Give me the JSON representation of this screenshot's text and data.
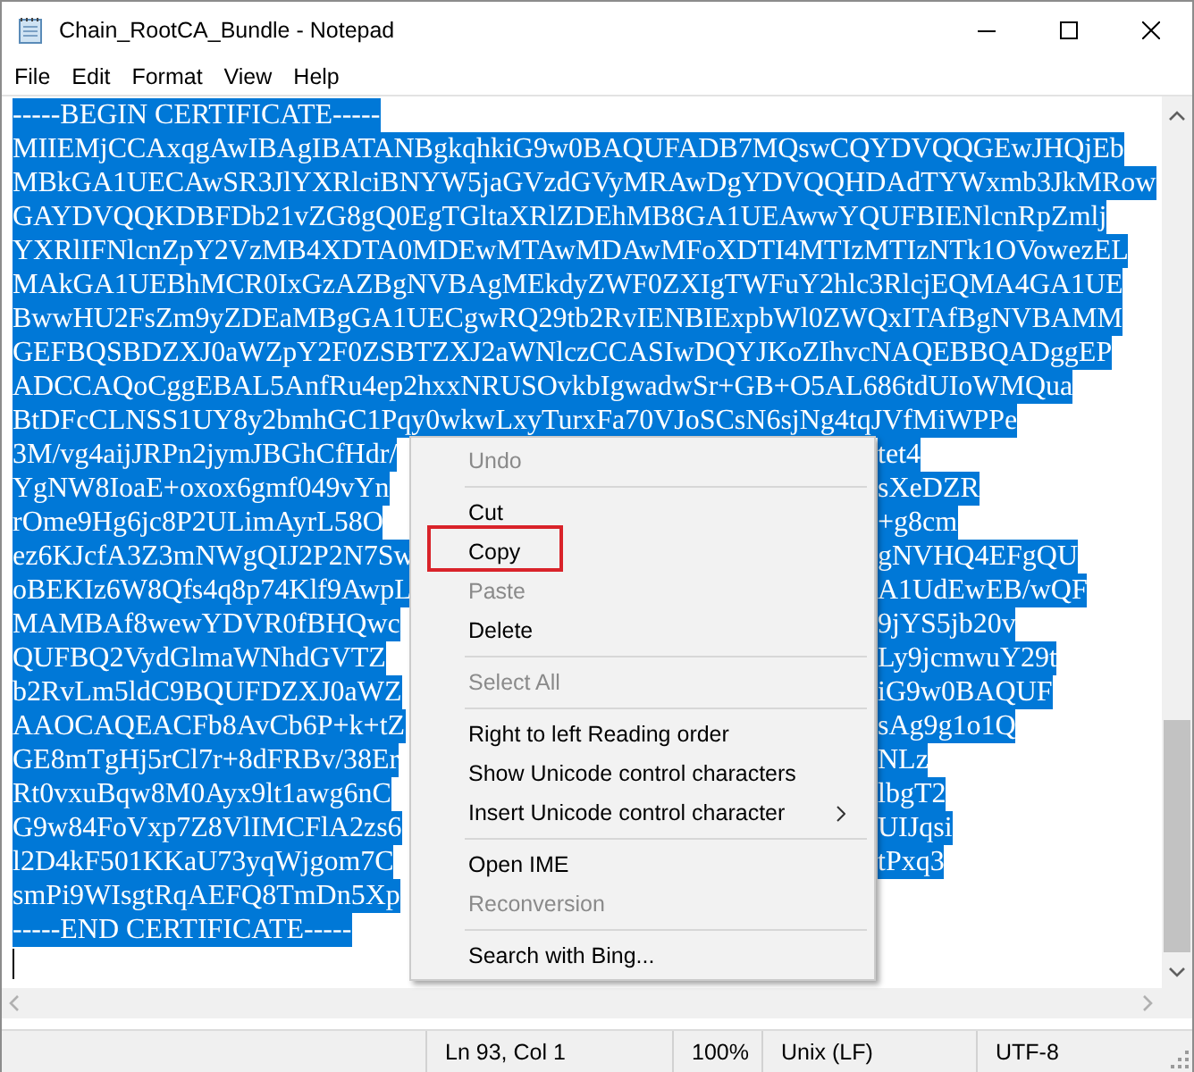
{
  "window": {
    "title": "Chain_RootCA_Bundle - Notepad"
  },
  "menu_bar": [
    "File",
    "Edit",
    "Format",
    "View",
    "Help"
  ],
  "editor": {
    "selected": true,
    "lines": [
      {
        "kind": "full",
        "text": "-----BEGIN CERTIFICATE-----"
      },
      {
        "kind": "full",
        "text": "MIIEMjCCAxqgAwIBAgIBATANBgkqhkiG9w0BAQUFADB7MQswCQYDVQQGEwJHQjEb"
      },
      {
        "kind": "full",
        "text": "MBkGA1UECAwSR3JlYXRlciBNYW5jaGVzdGVyMRAwDgYDVQQHDAdTYWxmb3JkMRow"
      },
      {
        "kind": "full",
        "text": "GAYDVQQKDBFDb21vZG8gQ0EgTGltaXRlZDEhMB8GA1UEAwwYQUFBIENlcnRpZmlj"
      },
      {
        "kind": "full",
        "text": "YXRlIFNlcnZpY2VzMB4XDTA0MDEwMTAwMDAwMFoXDTI4MTIzMTIzNTk1OVowezEL"
      },
      {
        "kind": "full",
        "text": "MAkGA1UEBhMCR0IxGzAZBgNVBAgMEkdyZWF0ZXIgTWFuY2hlc3RlcjEQMA4GA1UE"
      },
      {
        "kind": "full",
        "text": "BwwHU2FsZm9yZDEaMBgGA1UECgwRQ29tb2RvIENBIExpbWl0ZWQxITAfBgNVBAMM"
      },
      {
        "kind": "full",
        "text": "GEFBQSBDZXJ0aWZpY2F0ZSBTZXJ2aWNlczCCASIwDQYJKoZIhvcNAQEBBQADggEP"
      },
      {
        "kind": "full",
        "text": "ADCCAQoCggEBAL5AnfRu4ep2hxxNRUSOvkbIgwadwSr+GB+O5AL686tdUIoWMQua"
      },
      {
        "kind": "full",
        "text": "BtDFcCLNSS1UY8y2bmhGC1Pqy0wkwLxyTurxFa70VJoSCsN6sjNg4tqJVfMiWPPe"
      },
      {
        "kind": "split",
        "left": "3M/vg4aijJRPn2jymJBGhCfHdr/",
        "right": "tet4"
      },
      {
        "kind": "split",
        "left": "YgNW8IoaE+oxox6gmf049vYn",
        "right": "sXeDZR"
      },
      {
        "kind": "split",
        "left": "rOme9Hg6jc8P2ULimAyrL58O",
        "right": "+g8cm"
      },
      {
        "kind": "split",
        "left": "ez6KJcfA3Z3mNWgQIJ2P2N7Sw",
        "right": "gNVHQ4EFgQU"
      },
      {
        "kind": "split",
        "left": "oBEKIz6W8Qfs4q8p74Klf9AwpL",
        "right": "A1UdEwEB/wQF"
      },
      {
        "kind": "split",
        "left": "MAMBAf8wewYDVR0fBHQwc",
        "right": "9jYS5jb20v"
      },
      {
        "kind": "split",
        "left": "QUFBQ2VydGlmaWNhdGVTZ",
        "right": "Ly9jcmwuY29t"
      },
      {
        "kind": "split",
        "left": "b2RvLm5ldC9BQUFDZXJ0aWZ",
        "right": "iG9w0BAQUF"
      },
      {
        "kind": "split",
        "left": "AAOCAQEACFb8AvCb6P+k+tZ",
        "right": "sAg9g1o1Q"
      },
      {
        "kind": "split",
        "left": "GE8mTgHj5rCl7r+8dFRBv/38Er",
        "right": "NLz"
      },
      {
        "kind": "split",
        "left": "Rt0vxuBqw8M0Ayx9lt1awg6nC",
        "right": "lbgT2"
      },
      {
        "kind": "split",
        "left": "G9w84FoVxp7Z8VlIMCFlA2zs6",
        "right": "UIJqsi"
      },
      {
        "kind": "split",
        "left": "l2D4kF501KKaU73yqWjgom7C",
        "right": "tPxq3"
      },
      {
        "kind": "split",
        "left": "smPi9WIsgtRqAEFQ8TmDn5Xp"
      },
      {
        "kind": "full",
        "text": "-----END CERTIFICATE-----"
      }
    ]
  },
  "context_menu": {
    "items": [
      {
        "kind": "item",
        "label": "Undo",
        "disabled": true,
        "annotated": false
      },
      {
        "kind": "separator"
      },
      {
        "kind": "item",
        "label": "Cut",
        "disabled": false,
        "annotated": false
      },
      {
        "kind": "item",
        "label": "Copy",
        "disabled": false,
        "annotated": true
      },
      {
        "kind": "item",
        "label": "Paste",
        "disabled": true,
        "annotated": false
      },
      {
        "kind": "item",
        "label": "Delete",
        "disabled": false,
        "annotated": false
      },
      {
        "kind": "separator"
      },
      {
        "kind": "item",
        "label": "Select All",
        "disabled": true,
        "annotated": false
      },
      {
        "kind": "separator"
      },
      {
        "kind": "item",
        "label": "Right to left Reading order",
        "disabled": false,
        "annotated": false
      },
      {
        "kind": "item",
        "label": "Show Unicode control characters",
        "disabled": false,
        "annotated": false
      },
      {
        "kind": "submenu",
        "label": "Insert Unicode control character",
        "disabled": false,
        "annotated": false
      },
      {
        "kind": "separator"
      },
      {
        "kind": "item",
        "label": "Open IME",
        "disabled": false,
        "annotated": false
      },
      {
        "kind": "item",
        "label": "Reconversion",
        "disabled": true,
        "annotated": false
      },
      {
        "kind": "separator"
      },
      {
        "kind": "item",
        "label": "Search with Bing...",
        "disabled": false,
        "annotated": false
      }
    ]
  },
  "status_bar": [
    "Ln 93, Col 1",
    "100%",
    "Unix (LF)",
    "UTF-8"
  ]
}
